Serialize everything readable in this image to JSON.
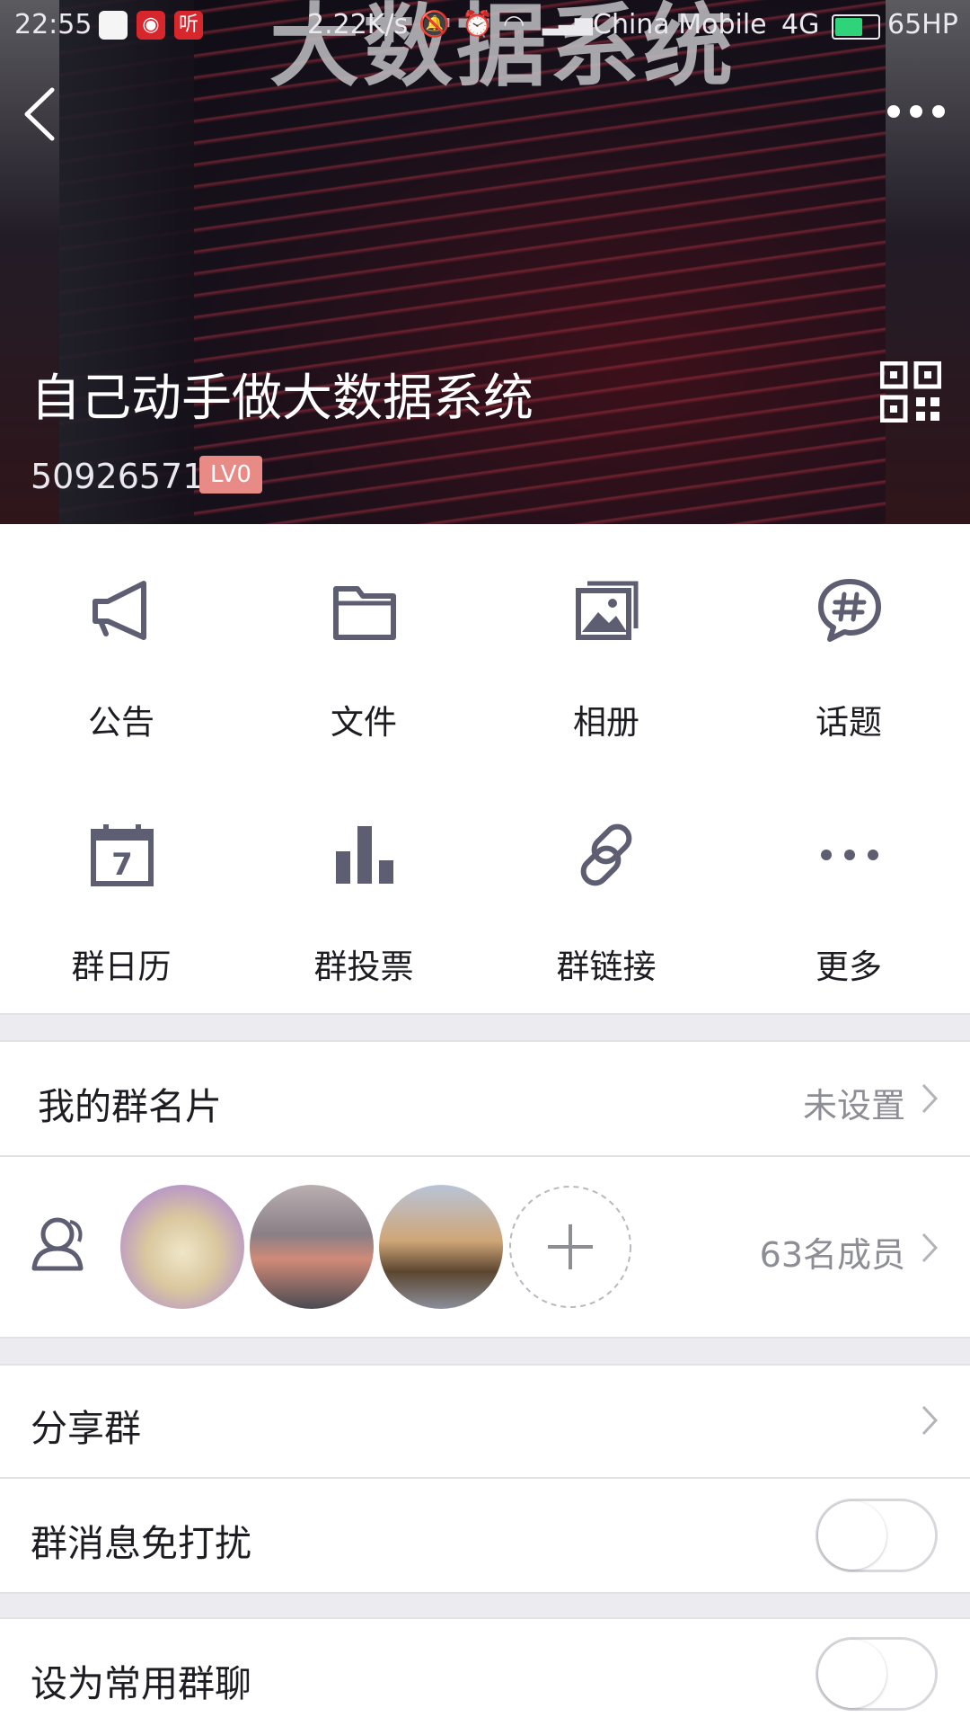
{
  "status_bar": {
    "time": "22:55",
    "speed": "2.22K/s",
    "carrier": "China Mobile",
    "network": "4G",
    "battery": "65HP",
    "app_icon_label": "听"
  },
  "header": {
    "group_name": "自己动手做大数据系统",
    "group_id": "50926571",
    "level_badge": "LV0",
    "cover_text": "大数据系统"
  },
  "features": [
    {
      "label": "公告",
      "icon": "megaphone-icon"
    },
    {
      "label": "文件",
      "icon": "folder-icon"
    },
    {
      "label": "相册",
      "icon": "album-icon"
    },
    {
      "label": "话题",
      "icon": "topic-icon"
    },
    {
      "label": "群日历",
      "icon": "calendar-icon"
    },
    {
      "label": "群投票",
      "icon": "vote-icon"
    },
    {
      "label": "群链接",
      "icon": "link-icon"
    },
    {
      "label": "更多",
      "icon": "more-icon"
    }
  ],
  "my_card": {
    "title": "我的群名片",
    "value": "未设置"
  },
  "members": {
    "count_label": "63名成员"
  },
  "share": {
    "title": "分享群"
  },
  "mute": {
    "title": "群消息免打扰",
    "enabled": false
  },
  "favorite": {
    "title": "设为常用群聊",
    "enabled": false
  },
  "colors": {
    "icon": "#5d5e72",
    "badge": "#e88a86",
    "text": "#1c1c22",
    "muted": "#8d8d95"
  }
}
